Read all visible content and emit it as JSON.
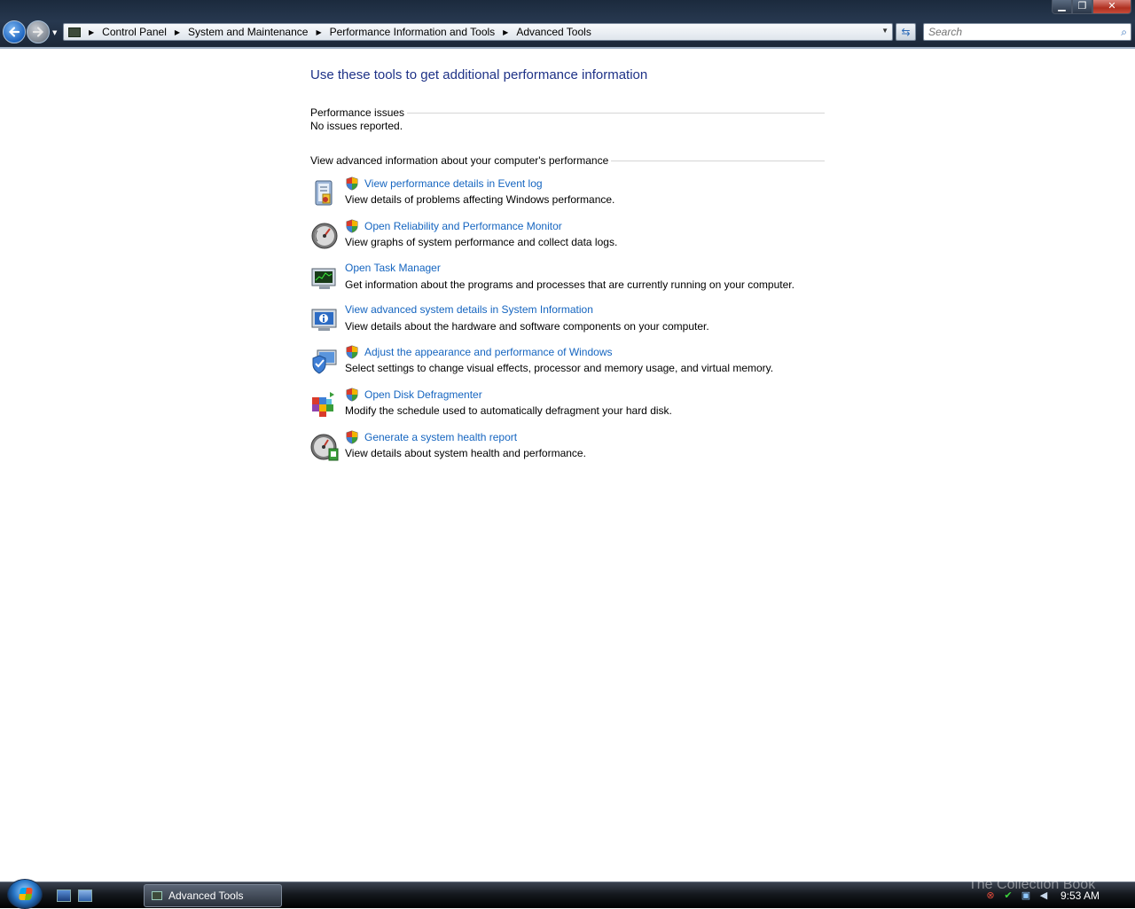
{
  "window": {
    "minimize_label": "▁",
    "maximize_label": "❐",
    "close_label": "✕"
  },
  "nav": {
    "back_icon": "back-arrow-icon",
    "forward_icon": "forward-arrow-icon"
  },
  "address": {
    "crumbs": [
      "Control Panel",
      "System and Maintenance",
      "Performance Information and Tools",
      "Advanced Tools"
    ]
  },
  "search": {
    "placeholder": "Search"
  },
  "main": {
    "title": "Use these tools to get additional performance information",
    "perf_issues_heading": "Performance issues",
    "perf_issues_status": "No issues reported.",
    "advanced_heading": "View advanced information about your computer's performance",
    "tools": [
      {
        "link": "View performance details in Event log",
        "desc": "View details of problems affecting Windows performance.",
        "icon": "event-log-icon",
        "shield": true
      },
      {
        "link": "Open Reliability and Performance Monitor",
        "desc": "View graphs of system performance and collect data logs.",
        "icon": "performance-monitor-icon",
        "shield": true
      },
      {
        "link": "Open Task Manager",
        "desc": "Get information about the programs and processes that are currently running on your computer.",
        "icon": "task-manager-icon",
        "shield": false
      },
      {
        "link": "View advanced system details in System Information",
        "desc": "View details about the hardware and software components on your computer.",
        "icon": "system-information-icon",
        "shield": false
      },
      {
        "link": "Adjust the appearance and performance of Windows",
        "desc": "Select settings to change visual effects, processor and memory usage, and virtual memory.",
        "icon": "visual-effects-icon",
        "shield": true
      },
      {
        "link": "Open Disk Defragmenter",
        "desc": "Modify the schedule used to automatically defragment your hard disk.",
        "icon": "disk-defragmenter-icon",
        "shield": true
      },
      {
        "link": "Generate a system health report",
        "desc": "View details about system health and performance.",
        "icon": "system-health-icon",
        "shield": true
      }
    ]
  },
  "taskbar": {
    "task_label": "Advanced Tools",
    "clock": "9:53 AM",
    "watermark": "The Collection Book"
  },
  "colors": {
    "link": "#1565c0",
    "title": "#1e3287",
    "chrome": "#1b2a3d"
  }
}
